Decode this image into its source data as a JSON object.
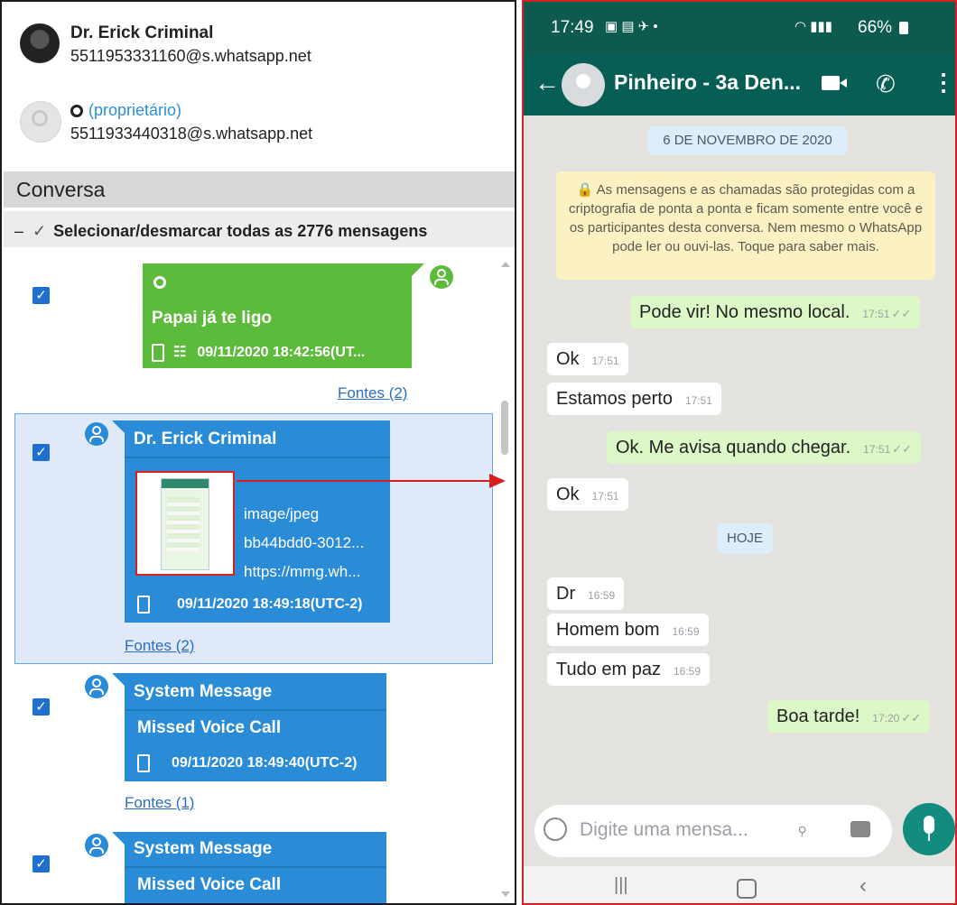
{
  "left_panel": {
    "contacts": [
      {
        "name": "Dr. Erick Criminal",
        "address": "5511953331160@s.whatsapp.net"
      },
      {
        "name": "(proprietário)",
        "address": "5511933440318@s.whatsapp.net"
      }
    ],
    "section_title": "Conversa",
    "select_all_label": "Selecionar/desmarcar todas as 2776 mensagens",
    "messages": [
      {
        "text": "Papai já te ligo",
        "timestamp": "09/11/2020 18:42:56(UT...",
        "fontes": "Fontes (2)"
      },
      {
        "title": "Dr. Erick Criminal",
        "mime": "image/jpeg",
        "hash": "bb44bdd0-3012...",
        "url": "https://mmg.wh...",
        "timestamp": "09/11/2020 18:49:18(UTC-2)",
        "fontes": "Fontes (2)"
      },
      {
        "title": "System Message",
        "text": "Missed Voice Call",
        "timestamp": "09/11/2020 18:49:40(UTC-2)",
        "fontes": "Fontes (1)"
      },
      {
        "title": "System Message",
        "text": "Missed Voice Call"
      }
    ],
    "checkbox_mark": "✓"
  },
  "right_panel": {
    "status": {
      "time": "17:49",
      "battery": "66%"
    },
    "chat_title": "Pinheiro - 3a Den...",
    "date_pill": "6 DE NOVEMBRO DE 2020",
    "encryption_notice": "As mensagens e as chamadas são protegidas com a criptografia de ponta a ponta e ficam somente entre você e os participantes desta conversa. Nem mesmo o WhatsApp pode ler ou ouvi-las. Toque para saber mais.",
    "today_pill": "HOJE",
    "chat": [
      {
        "text": "Pode vir! No mesmo local.",
        "time": "17:51",
        "dir": "out"
      },
      {
        "text": "Ok",
        "time": "17:51",
        "dir": "in"
      },
      {
        "text": "Estamos perto",
        "time": "17:51",
        "dir": "in"
      },
      {
        "text": "Ok. Me avisa quando chegar.",
        "time": "17:51",
        "dir": "out"
      },
      {
        "text": "Ok",
        "time": "17:51",
        "dir": "in"
      },
      {
        "text": "Dr",
        "time": "16:59",
        "dir": "in"
      },
      {
        "text": "Homem bom",
        "time": "16:59",
        "dir": "in"
      },
      {
        "text": "Tudo em paz",
        "time": "16:59",
        "dir": "in"
      },
      {
        "text": "Boa tarde!",
        "time": "17:20",
        "dir": "out"
      }
    ],
    "input_placeholder": "Digite uma mensa...",
    "colors": {
      "header": "#075e54",
      "outgoing": "#dcf8c6",
      "incoming": "#ffffff",
      "chat_bg": "#e4e2de",
      "accent": "#128c7e"
    }
  }
}
